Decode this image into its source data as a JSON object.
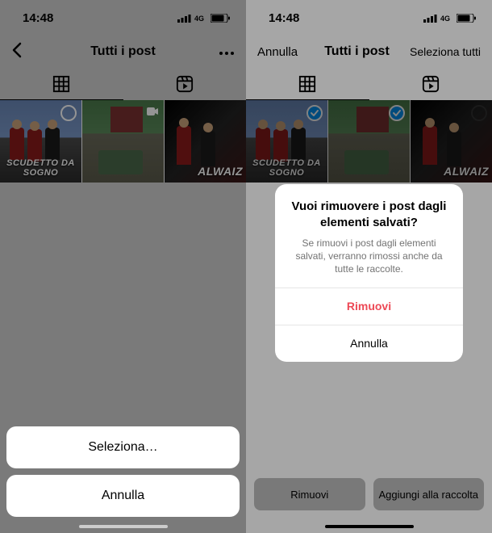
{
  "status": {
    "time": "14:48"
  },
  "left": {
    "nav": {
      "title": "Tutti i post"
    },
    "cells": [
      {
        "label": "SCUDETTO DA SOGNO"
      },
      {
        "label": ""
      },
      {
        "label": "ALWAIZ"
      }
    ],
    "sheet": {
      "select": "Seleziona…",
      "cancel": "Annulla"
    }
  },
  "right": {
    "nav": {
      "cancel": "Annulla",
      "title": "Tutti i post",
      "select_all": "Seleziona tutti"
    },
    "cells": [
      {
        "label": "SCUDETTO DA SOGNO"
      },
      {
        "label": ""
      },
      {
        "label": "ALWAIZ"
      }
    ],
    "modal": {
      "title": "Vuoi rimuovere i post dagli elementi salvati?",
      "message": "Se rimuovi i post dagli elementi salvati, verranno rimossi anche da tutte le raccolte.",
      "remove": "Rimuovi",
      "cancel": "Annulla"
    },
    "bottom": {
      "remove": "Rimuovi",
      "add": "Aggiungi alla raccolta"
    }
  }
}
